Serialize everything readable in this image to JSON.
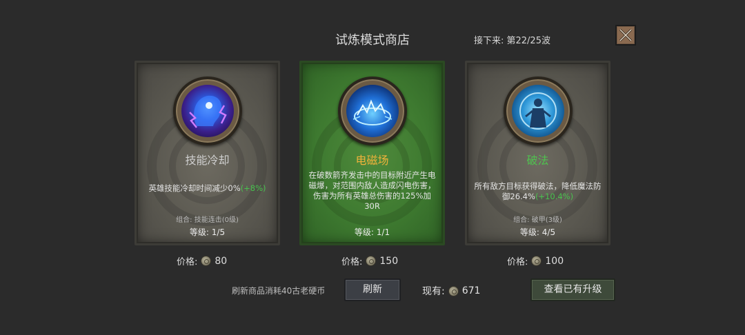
{
  "header": {
    "title": "试炼模式商店",
    "wave_text": "接下来: 第22/25波"
  },
  "cards": [
    {
      "icon": "mind-lightning-icon",
      "name": "技能冷却",
      "name_color": "#cfcfcf",
      "desc": "英雄技能冷却时间减少0%",
      "bonus": "(+8%)",
      "combo": "组合: 技能连击(0级)",
      "level": "等级: 1/5",
      "price_label": "价格:",
      "price": "80",
      "selected": false
    },
    {
      "icon": "electric-field-icon",
      "name": "电磁场",
      "name_color": "#f0b23a",
      "desc": "在破数箭齐发击中的目标附近产生电磁爆，对范围内敌人造成闪电伤害，伤害为所有英雄总伤害的125%加30R",
      "bonus": "",
      "combo": "",
      "level": "等级: 1/1",
      "price_label": "价格:",
      "price": "150",
      "selected": true
    },
    {
      "icon": "dispel-mage-icon",
      "name": "破法",
      "name_color": "#4fc24f",
      "desc": "所有敌方目标获得破法，降低魔法防御26.4%",
      "bonus": "(+10.4%)",
      "combo": "组合: 破甲(3级)",
      "level": "等级: 4/5",
      "price_label": "价格:",
      "price": "100",
      "selected": false
    }
  ],
  "footer": {
    "refresh_cost_text": "刷新商品消耗40古老硬币",
    "refresh_label": "刷新",
    "owned_label": "现有:",
    "owned_value": "671",
    "view_upgrades_label": "查看已有升级"
  }
}
